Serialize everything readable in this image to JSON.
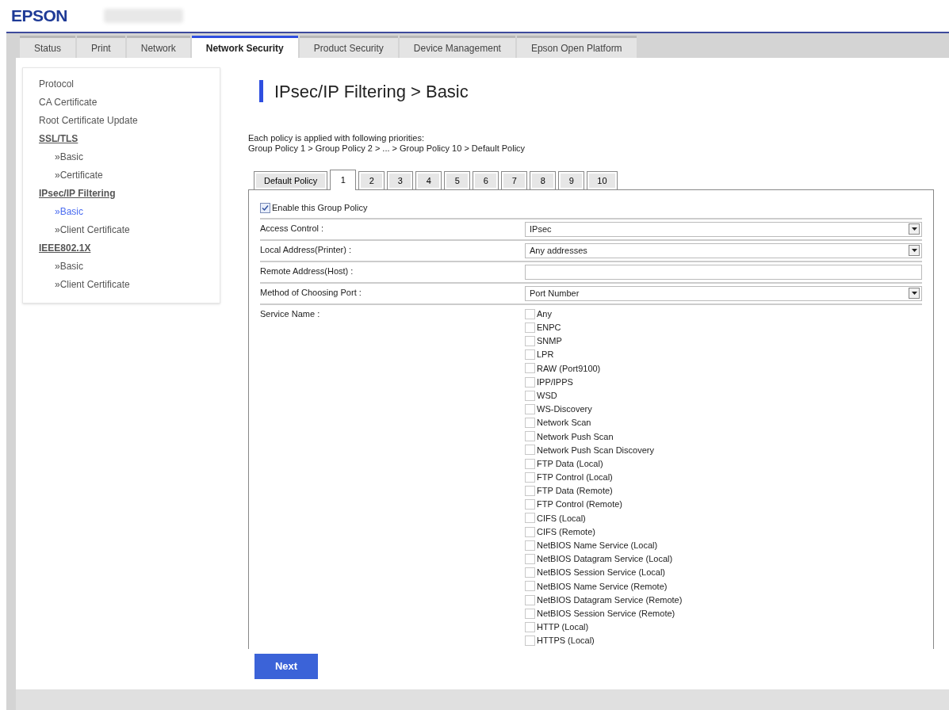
{
  "header": {
    "brand": "EPSON"
  },
  "top_tabs": [
    {
      "label": "Status",
      "selected": false
    },
    {
      "label": "Print",
      "selected": false
    },
    {
      "label": "Network",
      "selected": false
    },
    {
      "label": "Network Security",
      "selected": true
    },
    {
      "label": "Product Security",
      "selected": false
    },
    {
      "label": "Device Management",
      "selected": false
    },
    {
      "label": "Epson Open Platform",
      "selected": false
    }
  ],
  "sidebar": {
    "items": [
      {
        "label": "Protocol",
        "kind": "link",
        "selected": false
      },
      {
        "label": "CA Certificate",
        "kind": "link",
        "selected": false
      },
      {
        "label": "Root Certificate Update",
        "kind": "link",
        "selected": false
      },
      {
        "label": "SSL/TLS",
        "kind": "heading",
        "selected": false,
        "children": [
          {
            "label": "»Basic",
            "selected": false
          },
          {
            "label": "»Certificate",
            "selected": false
          }
        ]
      },
      {
        "label": "IPsec/IP Filtering",
        "kind": "heading",
        "selected": false,
        "children": [
          {
            "label": "»Basic",
            "selected": true
          },
          {
            "label": "»Client Certificate",
            "selected": false
          }
        ]
      },
      {
        "label": "IEEE802.1X",
        "kind": "heading",
        "selected": false,
        "children": [
          {
            "label": "»Basic",
            "selected": false
          },
          {
            "label": "»Client Certificate",
            "selected": false
          }
        ]
      }
    ]
  },
  "page_title": "IPsec/IP Filtering > Basic",
  "description": [
    "Each policy is applied with following priorities:",
    "Group Policy 1 > Group Policy 2 > ... > Group Policy 10 > Default Policy"
  ],
  "policy_tabs": [
    {
      "label": "Default Policy",
      "selected": false
    },
    {
      "label": "1",
      "selected": true
    },
    {
      "label": "2",
      "selected": false
    },
    {
      "label": "3",
      "selected": false
    },
    {
      "label": "4",
      "selected": false
    },
    {
      "label": "5",
      "selected": false
    },
    {
      "label": "6",
      "selected": false
    },
    {
      "label": "7",
      "selected": false
    },
    {
      "label": "8",
      "selected": false
    },
    {
      "label": "9",
      "selected": false
    },
    {
      "label": "10",
      "selected": false
    }
  ],
  "enable": {
    "label": "Enable this Group Policy",
    "checked": true
  },
  "fields": [
    {
      "label": "Access Control :",
      "kind": "select",
      "value": "IPsec"
    },
    {
      "label": "Local Address(Printer) :",
      "kind": "select",
      "value": "Any addresses"
    },
    {
      "label": "Remote Address(Host) :",
      "kind": "text"
    },
    {
      "label": "Method of Choosing Port :",
      "kind": "select",
      "value": "Port Number"
    }
  ],
  "service_name": {
    "label": "Service Name :",
    "options": [
      {
        "label": "Any",
        "checked": false
      },
      {
        "label": "ENPC",
        "checked": false
      },
      {
        "label": "SNMP",
        "checked": false
      },
      {
        "label": "LPR",
        "checked": false
      },
      {
        "label": "RAW (Port9100)",
        "checked": false
      },
      {
        "label": "IPP/IPPS",
        "checked": false
      },
      {
        "label": "WSD",
        "checked": false
      },
      {
        "label": "WS-Discovery",
        "checked": false
      },
      {
        "label": "Network Scan",
        "checked": false
      },
      {
        "label": "Network Push Scan",
        "checked": false
      },
      {
        "label": "Network Push Scan Discovery",
        "checked": false
      },
      {
        "label": "FTP Data (Local)",
        "checked": false
      },
      {
        "label": "FTP Control (Local)",
        "checked": false
      },
      {
        "label": "FTP Data (Remote)",
        "checked": false
      },
      {
        "label": "FTP Control (Remote)",
        "checked": false
      },
      {
        "label": "CIFS (Local)",
        "checked": false
      },
      {
        "label": "CIFS (Remote)",
        "checked": false
      },
      {
        "label": "NetBIOS Name Service (Local)",
        "checked": false
      },
      {
        "label": "NetBIOS Datagram Service (Local)",
        "checked": false
      },
      {
        "label": "NetBIOS Session Service (Local)",
        "checked": false
      },
      {
        "label": "NetBIOS Name Service (Remote)",
        "checked": false
      },
      {
        "label": "NetBIOS Datagram Service (Remote)",
        "checked": false
      },
      {
        "label": "NetBIOS Session Service (Remote)",
        "checked": false
      },
      {
        "label": "HTTP (Local)",
        "checked": false
      },
      {
        "label": "HTTPS (Local)",
        "checked": false
      }
    ]
  },
  "next_button": "Next"
}
